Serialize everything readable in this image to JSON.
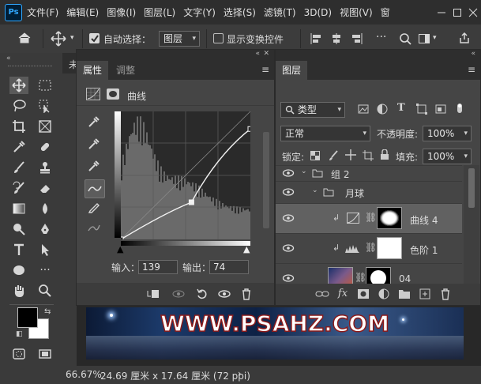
{
  "app": {
    "logo": "Ps"
  },
  "menubar": {
    "items": [
      "文件(F)",
      "编辑(E)",
      "图像(I)",
      "图层(L)",
      "文字(Y)",
      "选择(S)",
      "滤镜(T)",
      "3D(D)",
      "视图(V)",
      "窗"
    ]
  },
  "optbar": {
    "auto_select_label": "自动选择：",
    "auto_select_value": "图层",
    "show_transform_label": "显示变换控件"
  },
  "doc": {
    "tab_partial": "未",
    "banner_text": "WWW.PSAHZ.COM"
  },
  "status": {
    "zoom": "66.67%",
    "doc_size": "24.69 厘米 x 17.64 厘米 (72 ppi)"
  },
  "properties": {
    "tabs": [
      "属性",
      "调整"
    ],
    "adjustment_name": "曲线",
    "input_label": "输入：",
    "input_value": "139",
    "output_label": "输出：",
    "output_value": "74"
  },
  "layers": {
    "title": "图层",
    "filter_kind": "类型",
    "blend_mode": "正常",
    "opacity_label": "不透明度:",
    "opacity_value": "100%",
    "lock_label": "锁定:",
    "fill_label": "填充:",
    "fill_value": "100%",
    "groups": [
      {
        "name": "组 2"
      },
      {
        "name": "月球"
      }
    ],
    "rows": [
      {
        "name": "曲线 4",
        "selected": true
      },
      {
        "name": "色阶 1",
        "selected": false
      },
      {
        "name": "04",
        "selected": false
      }
    ]
  },
  "curve": {
    "points": [
      [
        0,
        0
      ],
      [
        139,
        74
      ],
      [
        255,
        220
      ]
    ]
  },
  "colors": {
    "foreground": "#000000",
    "background": "#ffffff",
    "accent": "#31a8ff"
  }
}
